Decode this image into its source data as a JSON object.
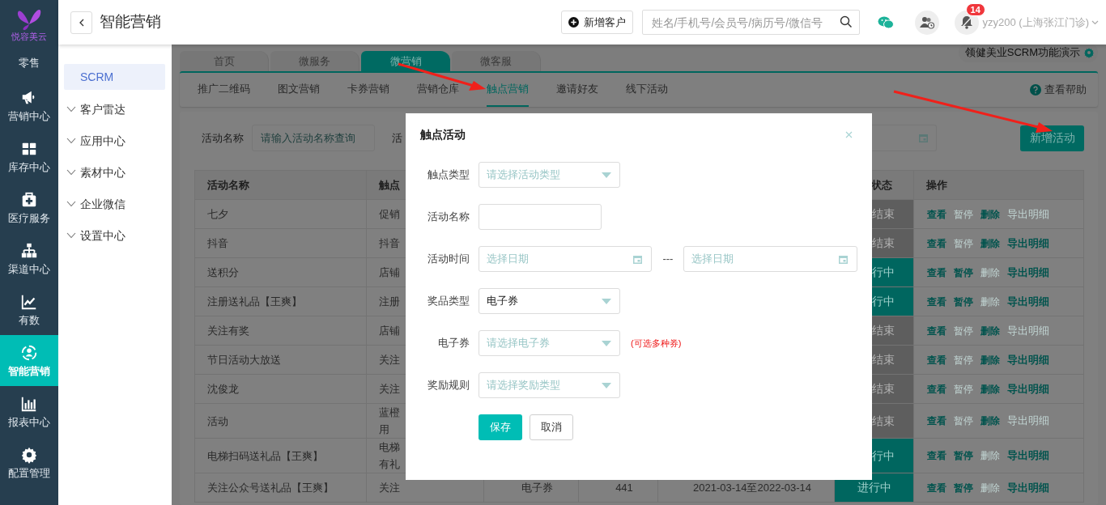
{
  "rail": {
    "logo_text": "悦容美云",
    "items": [
      {
        "label": "零售",
        "selected": false
      },
      {
        "label": "营销中心",
        "selected": false
      },
      {
        "label": "库存中心",
        "selected": false
      },
      {
        "label": "医疗服务",
        "selected": false
      },
      {
        "label": "渠道中心",
        "selected": false
      },
      {
        "label": "有数",
        "selected": false
      },
      {
        "label": "智能营销",
        "selected": true
      },
      {
        "label": "报表中心",
        "selected": false
      },
      {
        "label": "配置管理",
        "selected": false
      }
    ]
  },
  "header": {
    "title": "智能营销",
    "new_customer_button": "新增客户",
    "search_placeholder": "姓名/手机号/会员号/病历号/微信号",
    "notification_count": "14",
    "user": "yzy200 (上海张江门诊)"
  },
  "submenu": [
    {
      "label": "SCRM",
      "kind": "link",
      "selected": true
    },
    {
      "label": "客户雷达",
      "kind": "group",
      "selected": false
    },
    {
      "label": "应用中心",
      "kind": "group",
      "selected": false
    },
    {
      "label": "素材中心",
      "kind": "group",
      "selected": false
    },
    {
      "label": "企业微信",
      "kind": "group",
      "selected": false
    },
    {
      "label": "设置中心",
      "kind": "group",
      "selected": false
    }
  ],
  "tabs": [
    {
      "label": "首页",
      "selected": false
    },
    {
      "label": "微服务",
      "selected": false
    },
    {
      "label": "微营销",
      "selected": true
    },
    {
      "label": "微客服",
      "selected": false
    }
  ],
  "demo_label": "领健美业SCRM功能演示",
  "subnav": [
    {
      "label": "推广二维码",
      "selected": false
    },
    {
      "label": "图文营销",
      "selected": false
    },
    {
      "label": "卡券营销",
      "selected": false
    },
    {
      "label": "营销仓库",
      "selected": false
    },
    {
      "label": "触点营销",
      "selected": true
    },
    {
      "label": "邀请好友",
      "selected": false
    },
    {
      "label": "线下活动",
      "selected": false
    }
  ],
  "help": "查看帮助",
  "filter": {
    "name_label": "活动名称",
    "name_placeholder": "请输入活动名称查询",
    "second_label": "活"
  },
  "add_button": "新增活动",
  "table": {
    "columns": {
      "column_1": "活动名称",
      "column_2": "触点",
      "column_6": "状态",
      "column_7": "操作"
    },
    "rows": [
      {
        "name": "七夕",
        "type": "促销",
        "running": false,
        "status_text": "结束",
        "actions": [
          {
            "label": "查看",
            "disabled": false
          },
          {
            "label": "暂停",
            "disabled": true
          },
          {
            "label": "删除",
            "disabled": false
          },
          {
            "label": "导出明细",
            "disabled": true
          }
        ]
      },
      {
        "name": "抖音",
        "type": "抖音",
        "running": false,
        "status_text": "结束",
        "actions": [
          {
            "label": "查看",
            "disabled": false
          },
          {
            "label": "暂停",
            "disabled": true
          },
          {
            "label": "删除",
            "disabled": false
          },
          {
            "label": "导出明细",
            "disabled": false
          }
        ]
      },
      {
        "name": "送积分",
        "type": "店铺",
        "running": true,
        "status_text": "行中",
        "actions": [
          {
            "label": "查看",
            "disabled": false
          },
          {
            "label": "暂停",
            "disabled": false
          },
          {
            "label": "删除",
            "disabled": true
          },
          {
            "label": "导出明细",
            "disabled": false
          }
        ]
      },
      {
        "name": "注册送礼品【王爽】",
        "type": "注册",
        "running": true,
        "status_text": "行中",
        "actions": [
          {
            "label": "查看",
            "disabled": false
          },
          {
            "label": "暂停",
            "disabled": false
          },
          {
            "label": "删除",
            "disabled": true
          },
          {
            "label": "导出明细",
            "disabled": false
          }
        ]
      },
      {
        "name": "关注有奖",
        "type": "店铺",
        "running": false,
        "status_text": "结束",
        "actions": [
          {
            "label": "查看",
            "disabled": false
          },
          {
            "label": "暂停",
            "disabled": true
          },
          {
            "label": "删除",
            "disabled": false
          },
          {
            "label": "导出明细",
            "disabled": true
          }
        ]
      },
      {
        "name": "节日活动大放送",
        "type": "关注",
        "running": false,
        "status_text": "结束",
        "actions": [
          {
            "label": "查看",
            "disabled": false
          },
          {
            "label": "暂停",
            "disabled": true
          },
          {
            "label": "删除",
            "disabled": false
          },
          {
            "label": "导出明细",
            "disabled": false
          }
        ]
      },
      {
        "name": "沈俊龙",
        "type": "关注",
        "running": false,
        "status_text": "结束",
        "actions": [
          {
            "label": "查看",
            "disabled": false
          },
          {
            "label": "暂停",
            "disabled": true
          },
          {
            "label": "删除",
            "disabled": false
          },
          {
            "label": "导出明细",
            "disabled": false
          }
        ]
      },
      {
        "name": "活动",
        "type": "蓝橙用",
        "running": false,
        "status_text": "结束",
        "actions": [
          {
            "label": "查看",
            "disabled": false
          },
          {
            "label": "暂停",
            "disabled": true
          },
          {
            "label": "删除",
            "disabled": false
          },
          {
            "label": "导出明细",
            "disabled": true
          }
        ]
      },
      {
        "name": "电梯扫码送礼品【王爽】",
        "type": "电梯有礼",
        "running": true,
        "status_text": "行中",
        "actions": [
          {
            "label": "查看",
            "disabled": false
          },
          {
            "label": "暂停",
            "disabled": false
          },
          {
            "label": "删除",
            "disabled": true
          },
          {
            "label": "导出明细",
            "disabled": false
          }
        ]
      },
      {
        "name": "关注公众号送礼品【王爽】",
        "type": "关注",
        "column_3": "电子券",
        "column_4": "441",
        "column_5": "2021-03-14至2022-03-14",
        "running": true,
        "status_text": "进行中",
        "actions": [
          {
            "label": "查看",
            "disabled": false
          },
          {
            "label": "暂停",
            "disabled": false
          },
          {
            "label": "删除",
            "disabled": true
          },
          {
            "label": "导出明细",
            "disabled": false
          }
        ]
      }
    ]
  },
  "modal": {
    "title": "触点活动",
    "fields": [
      {
        "kind": "select",
        "label": "触点类型",
        "placeholder": "请选择活动类型"
      },
      {
        "kind": "input",
        "label": "活动名称"
      },
      {
        "kind": "daterange",
        "label": "活动时间",
        "placeholder": "选择日期",
        "separator": "---",
        "placeholder_2": "选择日期"
      },
      {
        "kind": "select",
        "label": "奖品类型",
        "value": "电子券"
      },
      {
        "kind": "select",
        "label": "电子券",
        "placeholder": "请选择电子券",
        "hint": "(可选多种券)"
      },
      {
        "kind": "select",
        "label": "奖励规则",
        "placeholder": "请选择奖励类型"
      }
    ],
    "save_button": "保存",
    "cancel_button": "取消"
  }
}
